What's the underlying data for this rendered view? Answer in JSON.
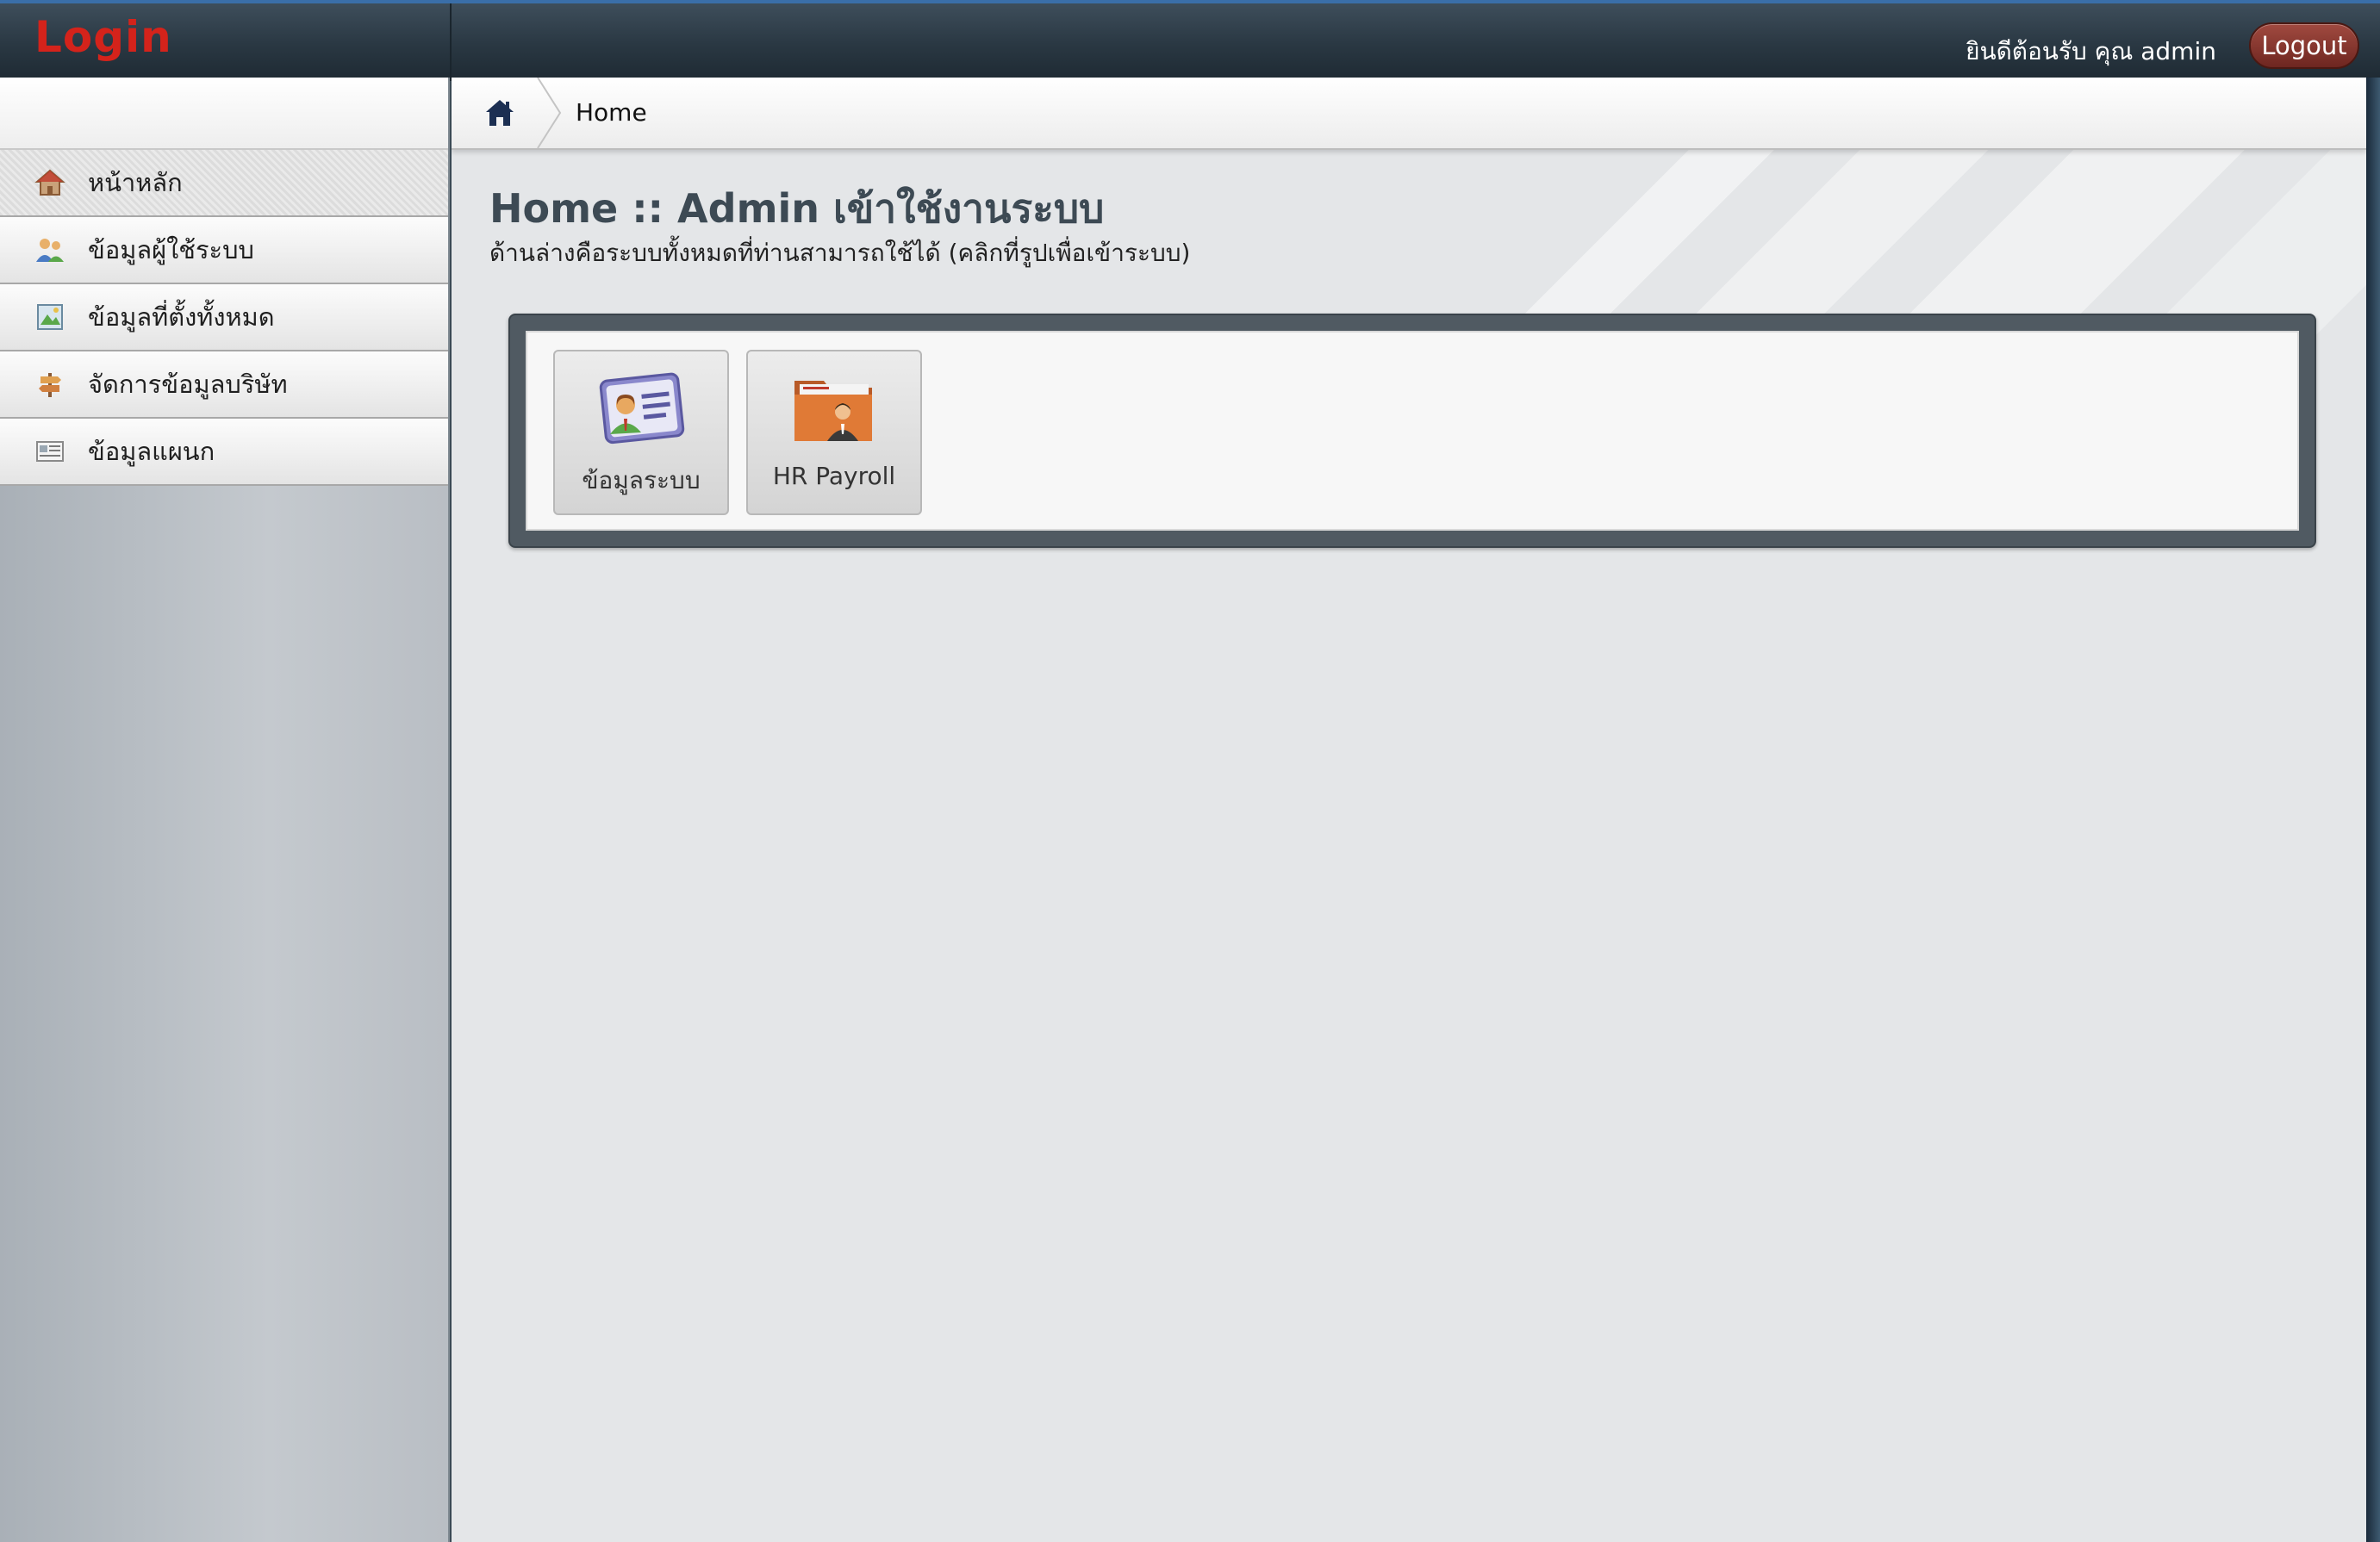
{
  "header": {
    "logo": "Login",
    "welcome": "ยินดีต้อนรับ คุณ admin",
    "logout_label": "Logout"
  },
  "sidebar": {
    "items": [
      {
        "label": "หน้าหลัก",
        "icon": "home-icon",
        "active": true
      },
      {
        "label": "ข้อมูลผู้ใช้ระบบ",
        "icon": "users-icon",
        "active": false
      },
      {
        "label": "ข้อมูลที่ตั้งทั้งหมด",
        "icon": "map-icon",
        "active": false
      },
      {
        "label": "จัดการข้อมูลบริษัท",
        "icon": "signpost-icon",
        "active": false
      },
      {
        "label": "ข้อมูลแผนก",
        "icon": "list-card-icon",
        "active": false
      }
    ]
  },
  "breadcrumb": {
    "home_icon": "home-icon",
    "current": "Home"
  },
  "main": {
    "title": "Home :: Admin เข้าใช้งานระบบ",
    "subtitle": "ด้านล่างคือระบบทั้งหมดที่ท่านสามารถใช้ได้ (คลิกที่รูปเพื่อเข้าระบบ)"
  },
  "apps": [
    {
      "label": "ข้อมูลระบบ",
      "icon": "id-card-icon"
    },
    {
      "label": "HR Payroll",
      "icon": "user-folder-icon"
    }
  ],
  "colors": {
    "logo": "#d4231b",
    "header_bg": "#2a3843",
    "logout_bg": "#8a3229",
    "title": "#3d4a54"
  }
}
